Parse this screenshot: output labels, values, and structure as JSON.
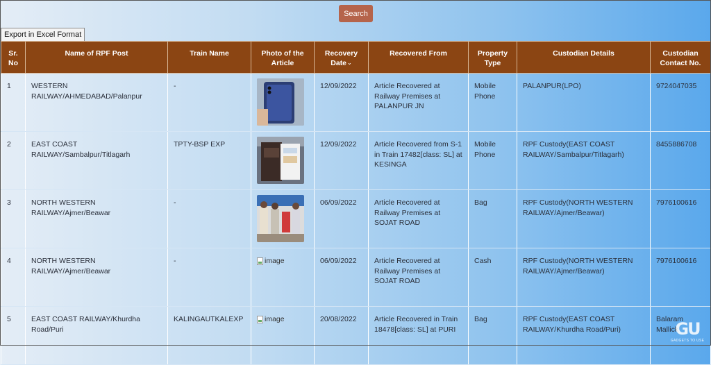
{
  "toolbar": {
    "search_label": "Search",
    "export_label": "Export in Excel Format"
  },
  "table": {
    "headers": {
      "sr": "Sr. No",
      "post": "Name of RPF Post",
      "train": "Train Name",
      "photo": "Photo of the Article",
      "date": "Recovery Date",
      "from": "Recovered From",
      "type": "Property Type",
      "custodian": "Custodian Details",
      "contact": "Custodian Contact No."
    },
    "rows": [
      {
        "sr": "1",
        "post": "WESTERN RAILWAY/AHMEDABAD/Palanpur",
        "train": "-",
        "photo_alt": "",
        "date": "12/09/2022",
        "from": "Article Recovered at Railway Premises at PALANPUR JN",
        "type": "Mobile Phone",
        "custodian": "PALANPUR(LPO)",
        "contact": "9724047035"
      },
      {
        "sr": "2",
        "post": "EAST COAST RAILWAY/Sambalpur/Titlagarh",
        "train": "TPTY-BSP EXP",
        "photo_alt": "",
        "date": "12/09/2022",
        "from": "Article Recovered from S-1 in Train 17482[class: SL] at KESINGA",
        "type": "Mobile Phone",
        "custodian": "RPF Custody(EAST COAST RAILWAY/Sambalpur/Titlagarh)",
        "contact": "8455886708"
      },
      {
        "sr": "3",
        "post": "NORTH WESTERN RAILWAY/Ajmer/Beawar",
        "train": "-",
        "photo_alt": "",
        "date": "06/09/2022",
        "from": "Article Recovered at Railway Premises at SOJAT ROAD",
        "type": "Bag",
        "custodian": "RPF Custody(NORTH WESTERN RAILWAY/Ajmer/Beawar)",
        "contact": "7976100616"
      },
      {
        "sr": "4",
        "post": "NORTH WESTERN RAILWAY/Ajmer/Beawar",
        "train": "-",
        "photo_alt": "image",
        "date": "06/09/2022",
        "from": "Article Recovered at Railway Premises at SOJAT ROAD",
        "type": "Cash",
        "custodian": "RPF Custody(NORTH WESTERN RAILWAY/Ajmer/Beawar)",
        "contact": "7976100616"
      },
      {
        "sr": "5",
        "post": "EAST COAST RAILWAY/Khurdha Road/Puri",
        "train": "KALINGAUTKALEXP",
        "photo_alt": "image",
        "date": "20/08/2022",
        "from": "Article Recovered in Train 18478[class: SL] at PURI",
        "type": "Bag",
        "custodian": "RPF Custody(EAST COAST RAILWAY/Khurdha Road/Puri)",
        "contact": "Balaram Mallick"
      }
    ]
  },
  "watermark": {
    "logo": "GU",
    "text": "GADGETS TO USE"
  },
  "colors": {
    "header_bg": "#8b4513",
    "search_bg": "#b5644b"
  }
}
